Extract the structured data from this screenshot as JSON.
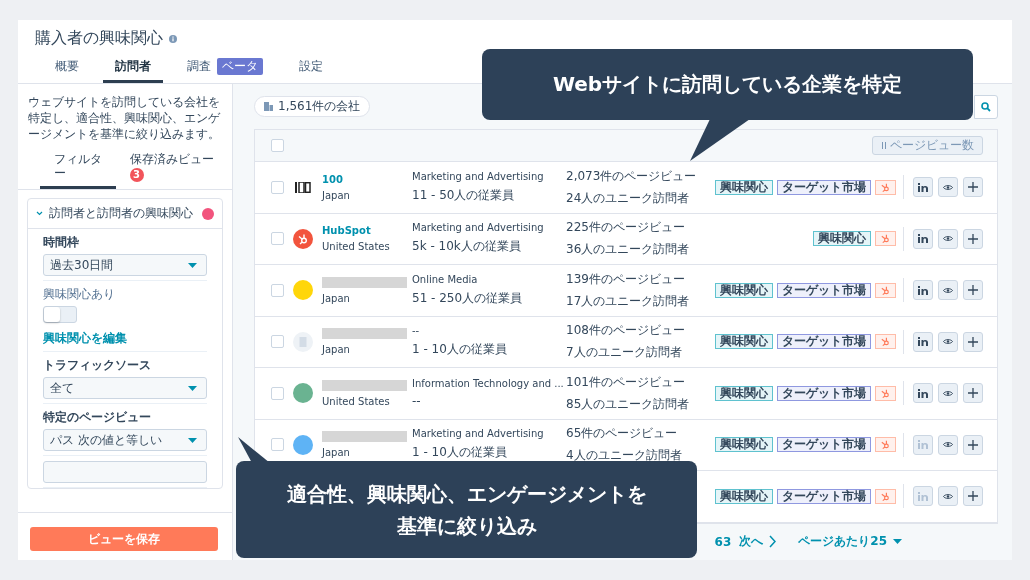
{
  "page": {
    "title": "購入者の興味関心",
    "tabs": [
      {
        "label": "概要",
        "selected": false
      },
      {
        "label": "訪問者",
        "selected": true
      },
      {
        "label": "調査",
        "selected": false,
        "badge": "ベータ"
      },
      {
        "label": "設定",
        "selected": false
      }
    ]
  },
  "sidebar": {
    "description": "ウェブサイトを訪問している会社を特定し、適合性、興味関心、エンゲージメントを基準に絞り込みます。",
    "tabs": [
      {
        "label": "フィルター",
        "selected": true
      },
      {
        "label": "保存済みビュー",
        "selected": false,
        "count": "3"
      }
    ],
    "filter_group": {
      "title": "訪問者と訪問者の興味関心",
      "expanded": true,
      "fields": [
        {
          "kind": "select",
          "label": "時間枠",
          "value": "過去30日間"
        },
        {
          "kind": "toggle",
          "label": "興味関心あり",
          "on": false,
          "link": "興味関心を編集"
        },
        {
          "kind": "select",
          "label": "トラフィックソース",
          "value": "全て"
        },
        {
          "kind": "select",
          "label": "特定のページビュー",
          "value": "パス 次の値と等しい"
        },
        {
          "kind": "input"
        }
      ]
    },
    "save_button": "ビューを保存"
  },
  "main": {
    "company_count": "1,561件の会社",
    "sort_button": "ページビュー数",
    "select_all_checked": false,
    "rows": [
      {
        "kind": "bars",
        "checked": false,
        "name": "100",
        "country": "Japan",
        "industry": "Marketing and Advertising",
        "size": "11 - 50人の従業員",
        "views": "2,073件のページビュー",
        "visitors": "24人のユニーク訪問者",
        "tags": [
          {
            "kind": "interest",
            "label": "興味関心"
          },
          {
            "kind": "target",
            "label": "ターゲット市場"
          },
          {
            "kind": "hubspot"
          }
        ],
        "linkedin_enabled": true
      },
      {
        "kind": "hubspot",
        "checked": false,
        "name": "HubSpot",
        "country": "United States",
        "industry": "Marketing and Advertising",
        "size": "5k - 10k人の従業員",
        "views": "225件のページビュー",
        "visitors": "36人のユニーク訪問者",
        "tags": [
          {
            "kind": "interest",
            "label": "興味関心"
          },
          {
            "kind": "hubspot"
          }
        ],
        "linkedin_enabled": true
      },
      {
        "kind": "circle",
        "checked": false,
        "color": "#ffd60a",
        "country": "Japan",
        "industry": "Online Media",
        "size": "51 - 250人の従業員",
        "views": "139件のページビュー",
        "visitors": "17人のユニーク訪問者",
        "tags": [
          {
            "kind": "interest",
            "label": "興味関心"
          },
          {
            "kind": "target",
            "label": "ターゲット市場"
          },
          {
            "kind": "hubspot"
          }
        ],
        "linkedin_enabled": true
      },
      {
        "kind": "building",
        "checked": false,
        "country": "Japan",
        "industry": "--",
        "size": "1 - 10人の従業員",
        "views": "108件のページビュー",
        "visitors": "7人のユニーク訪問者",
        "tags": [
          {
            "kind": "interest",
            "label": "興味関心"
          },
          {
            "kind": "target",
            "label": "ターゲット市場"
          },
          {
            "kind": "hubspot"
          }
        ],
        "linkedin_enabled": true
      },
      {
        "kind": "circle",
        "checked": false,
        "color": "#6ab391",
        "country": "United States",
        "industry": "Information Technology and ...",
        "size": "--",
        "views": "101件のページビュー",
        "visitors": "85人のユニーク訪問者",
        "tags": [
          {
            "kind": "interest",
            "label": "興味関心"
          },
          {
            "kind": "target",
            "label": "ターゲット市場"
          },
          {
            "kind": "hubspot"
          }
        ],
        "linkedin_enabled": true
      },
      {
        "kind": "circle",
        "checked": false,
        "color": "#5eb3f5",
        "country": "Japan",
        "industry": "Marketing and Advertising",
        "size": "1 - 10人の従業員",
        "views": "65件のページビュー",
        "visitors": "4人のユニーク訪問者",
        "tags": [
          {
            "kind": "interest",
            "label": "興味関心"
          },
          {
            "kind": "target",
            "label": "ターゲット市場"
          },
          {
            "kind": "hubspot"
          }
        ],
        "linkedin_enabled": false
      },
      {
        "covered": true,
        "tags": [
          {
            "kind": "interest",
            "label": "興味関心"
          },
          {
            "kind": "target",
            "label": "ターゲット市場"
          },
          {
            "kind": "hubspot"
          }
        ],
        "linkedin_enabled": false
      }
    ],
    "pagination": {
      "page": "63",
      "next": "次へ",
      "per_page": "ページあたり25"
    }
  },
  "callouts": [
    {
      "text": "Webサイトに訪問している企業を特定"
    },
    {
      "text": "適合性、興味関心、エンゲージメントを基準に絞り込み"
    }
  ]
}
